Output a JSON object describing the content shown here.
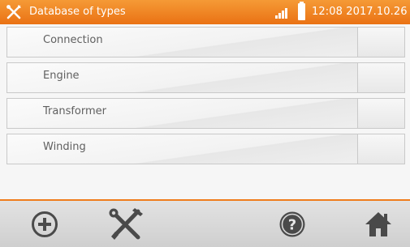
{
  "header": {
    "title": "Database of types",
    "datetime": "12:08 2017.10.26",
    "icons": [
      "tools-icon",
      "signal-icon",
      "battery-icon"
    ]
  },
  "list": {
    "items": [
      {
        "label": "Connection"
      },
      {
        "label": "Engine"
      },
      {
        "label": "Transformer"
      },
      {
        "label": "Winding"
      }
    ]
  },
  "toolbar": {
    "buttons": [
      "add-icon",
      "settings-icon",
      "help-icon",
      "home-icon"
    ]
  },
  "colors": {
    "accent": "#ef7d1c",
    "header_top": "#f59a36",
    "header_bottom": "#ea7214",
    "icon_dark": "#4a4a4a"
  }
}
